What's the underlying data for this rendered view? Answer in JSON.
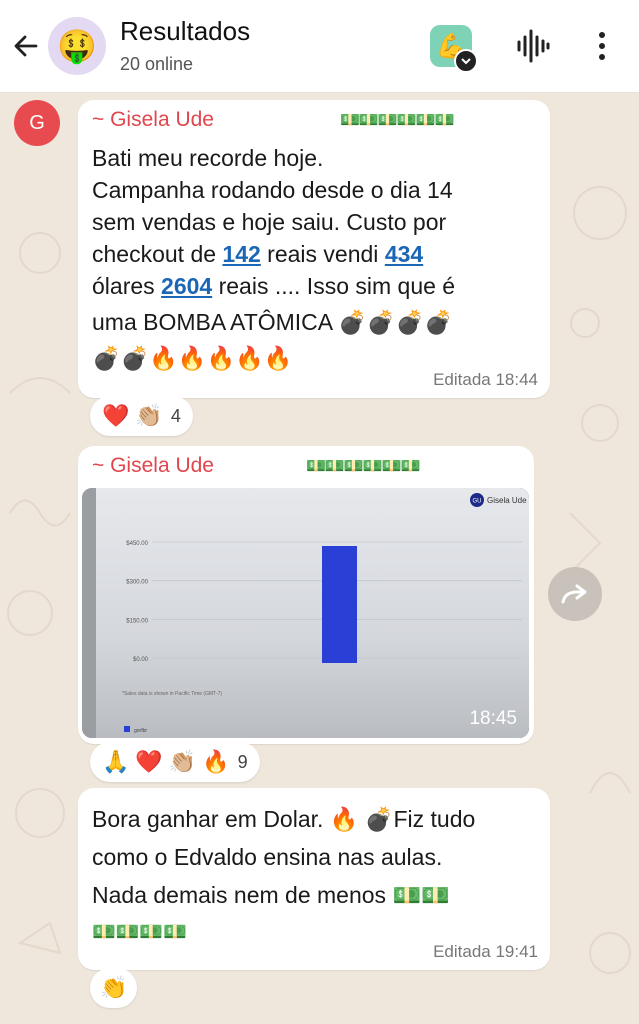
{
  "header": {
    "title": "Resultados",
    "subtitle": "20 online",
    "avatar_emoji": "🤑"
  },
  "messages": [
    {
      "sender": "~ Gisela Ude",
      "sender_badge": "💵💵💵💵💵💵",
      "avatar_letter": "G",
      "lines": [
        "Bati meu recorde hoje.",
        "Campanha rodando desde o dia 14",
        "sem vendas e hoje saiu. Custo por"
      ],
      "line4_pre": "checkout de ",
      "link1": "142",
      "line4_mid": " reais vendi ",
      "link2": "434",
      "line5_pre": "ólares ",
      "link3": "2604",
      "line5_post": " reais .... Isso sim que é",
      "line6": "uma BOMBA ATÔMICA 💣💣💣💣",
      "line7": "💣💣🔥🔥🔥🔥🔥",
      "meta": "Editada 18:44",
      "reactions": [
        "❤️",
        "👏🏼"
      ],
      "reaction_count": "4"
    },
    {
      "sender": "~ Gisela Ude",
      "sender_badge": "💵💵💵💵💵💵",
      "image_time": "18:45",
      "reactions": [
        "🙏",
        "❤️",
        "👏🏼",
        "🔥"
      ],
      "reaction_count": "9"
    },
    {
      "line1": "Bora ganhar em Dolar. 🔥 💣Fiz tudo",
      "line2": "como o Edvaldo ensina nas aulas.",
      "line3": "Nada demais nem de menos 💵💵",
      "line4": "💵💵💵💵",
      "meta": "Editada 19:41",
      "reactions": [
        "👏"
      ]
    }
  ],
  "chart_data": {
    "type": "bar",
    "title": "",
    "brand_label": "Gisela Ude",
    "brand_initials": "GU",
    "y_ticks": [
      "$450.00",
      "$300.00",
      "$150.00",
      "$0.00"
    ],
    "ylim": [
      0,
      450
    ],
    "categories": [
      ""
    ],
    "values": [
      450
    ],
    "bar_label": "",
    "footnote": "*Sales data is shown in Pacific Time (GMT-7)",
    "legend": "gorfbr",
    "bar_color": "#2a3fd6"
  },
  "colors": {
    "sender": "#e0464c",
    "link": "#1b67b5",
    "bg": "#efe7dc"
  }
}
